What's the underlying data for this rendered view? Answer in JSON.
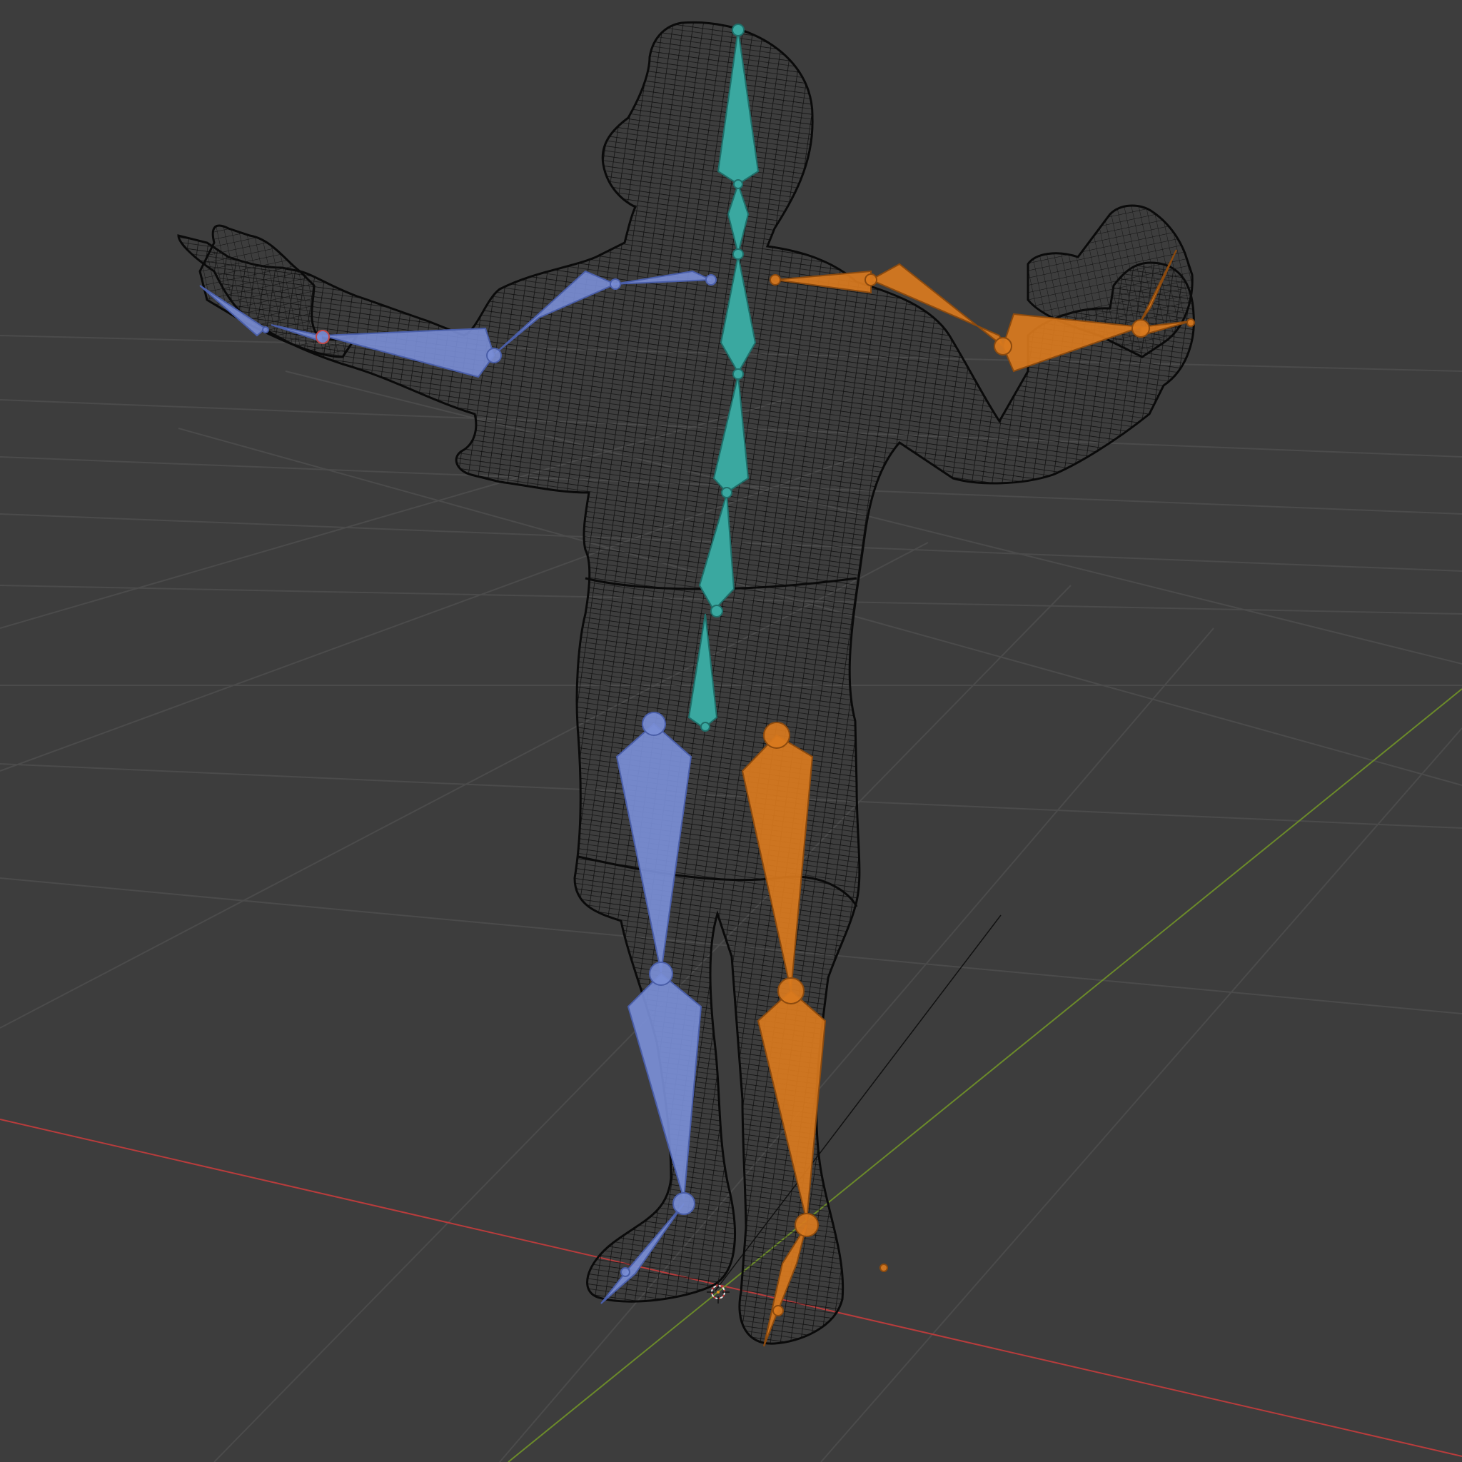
{
  "viewport": {
    "view": "3D Viewport",
    "shading": "wireframe",
    "background": "#3d3d3d",
    "grid_color": "#4a4a4a",
    "x_axis_color": "#b83c3c",
    "y_axis_color": "#6b8a2a"
  },
  "scene": {
    "mesh": {
      "name": "human-figure-wireframe",
      "wire_color": "#0a0a0a"
    },
    "armature": {
      "center_color": "#3aa8a0",
      "left_color": "#7a8ed6",
      "right_color": "#d97a1e"
    },
    "origin_marker": "3d-cursor-icon"
  }
}
